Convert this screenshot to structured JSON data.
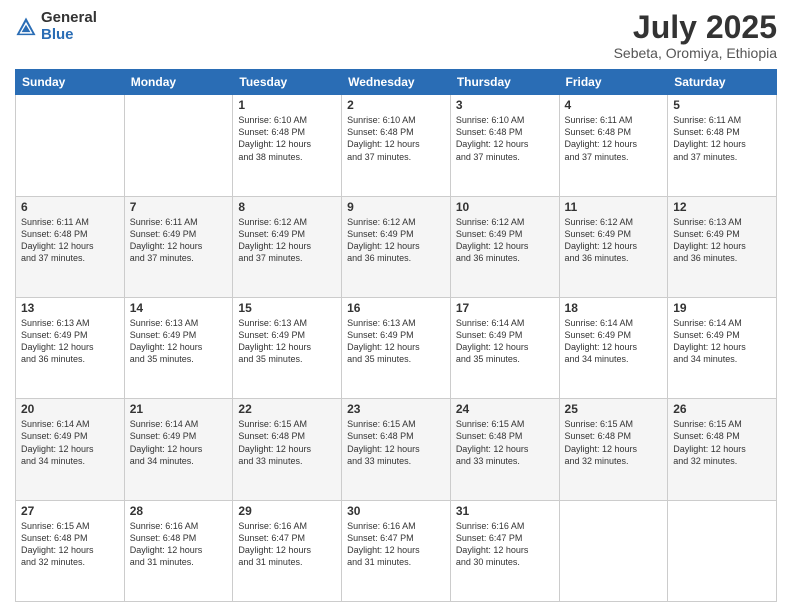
{
  "header": {
    "logo_general": "General",
    "logo_blue": "Blue",
    "month_year": "July 2025",
    "location": "Sebeta, Oromiya, Ethiopia"
  },
  "weekdays": [
    "Sunday",
    "Monday",
    "Tuesday",
    "Wednesday",
    "Thursday",
    "Friday",
    "Saturday"
  ],
  "weeks": [
    [
      {
        "day": "",
        "info": ""
      },
      {
        "day": "",
        "info": ""
      },
      {
        "day": "1",
        "info": "Sunrise: 6:10 AM\nSunset: 6:48 PM\nDaylight: 12 hours\nand 38 minutes."
      },
      {
        "day": "2",
        "info": "Sunrise: 6:10 AM\nSunset: 6:48 PM\nDaylight: 12 hours\nand 37 minutes."
      },
      {
        "day": "3",
        "info": "Sunrise: 6:10 AM\nSunset: 6:48 PM\nDaylight: 12 hours\nand 37 minutes."
      },
      {
        "day": "4",
        "info": "Sunrise: 6:11 AM\nSunset: 6:48 PM\nDaylight: 12 hours\nand 37 minutes."
      },
      {
        "day": "5",
        "info": "Sunrise: 6:11 AM\nSunset: 6:48 PM\nDaylight: 12 hours\nand 37 minutes."
      }
    ],
    [
      {
        "day": "6",
        "info": "Sunrise: 6:11 AM\nSunset: 6:48 PM\nDaylight: 12 hours\nand 37 minutes."
      },
      {
        "day": "7",
        "info": "Sunrise: 6:11 AM\nSunset: 6:49 PM\nDaylight: 12 hours\nand 37 minutes."
      },
      {
        "day": "8",
        "info": "Sunrise: 6:12 AM\nSunset: 6:49 PM\nDaylight: 12 hours\nand 37 minutes."
      },
      {
        "day": "9",
        "info": "Sunrise: 6:12 AM\nSunset: 6:49 PM\nDaylight: 12 hours\nand 36 minutes."
      },
      {
        "day": "10",
        "info": "Sunrise: 6:12 AM\nSunset: 6:49 PM\nDaylight: 12 hours\nand 36 minutes."
      },
      {
        "day": "11",
        "info": "Sunrise: 6:12 AM\nSunset: 6:49 PM\nDaylight: 12 hours\nand 36 minutes."
      },
      {
        "day": "12",
        "info": "Sunrise: 6:13 AM\nSunset: 6:49 PM\nDaylight: 12 hours\nand 36 minutes."
      }
    ],
    [
      {
        "day": "13",
        "info": "Sunrise: 6:13 AM\nSunset: 6:49 PM\nDaylight: 12 hours\nand 36 minutes."
      },
      {
        "day": "14",
        "info": "Sunrise: 6:13 AM\nSunset: 6:49 PM\nDaylight: 12 hours\nand 35 minutes."
      },
      {
        "day": "15",
        "info": "Sunrise: 6:13 AM\nSunset: 6:49 PM\nDaylight: 12 hours\nand 35 minutes."
      },
      {
        "day": "16",
        "info": "Sunrise: 6:13 AM\nSunset: 6:49 PM\nDaylight: 12 hours\nand 35 minutes."
      },
      {
        "day": "17",
        "info": "Sunrise: 6:14 AM\nSunset: 6:49 PM\nDaylight: 12 hours\nand 35 minutes."
      },
      {
        "day": "18",
        "info": "Sunrise: 6:14 AM\nSunset: 6:49 PM\nDaylight: 12 hours\nand 34 minutes."
      },
      {
        "day": "19",
        "info": "Sunrise: 6:14 AM\nSunset: 6:49 PM\nDaylight: 12 hours\nand 34 minutes."
      }
    ],
    [
      {
        "day": "20",
        "info": "Sunrise: 6:14 AM\nSunset: 6:49 PM\nDaylight: 12 hours\nand 34 minutes."
      },
      {
        "day": "21",
        "info": "Sunrise: 6:14 AM\nSunset: 6:49 PM\nDaylight: 12 hours\nand 34 minutes."
      },
      {
        "day": "22",
        "info": "Sunrise: 6:15 AM\nSunset: 6:48 PM\nDaylight: 12 hours\nand 33 minutes."
      },
      {
        "day": "23",
        "info": "Sunrise: 6:15 AM\nSunset: 6:48 PM\nDaylight: 12 hours\nand 33 minutes."
      },
      {
        "day": "24",
        "info": "Sunrise: 6:15 AM\nSunset: 6:48 PM\nDaylight: 12 hours\nand 33 minutes."
      },
      {
        "day": "25",
        "info": "Sunrise: 6:15 AM\nSunset: 6:48 PM\nDaylight: 12 hours\nand 32 minutes."
      },
      {
        "day": "26",
        "info": "Sunrise: 6:15 AM\nSunset: 6:48 PM\nDaylight: 12 hours\nand 32 minutes."
      }
    ],
    [
      {
        "day": "27",
        "info": "Sunrise: 6:15 AM\nSunset: 6:48 PM\nDaylight: 12 hours\nand 32 minutes."
      },
      {
        "day": "28",
        "info": "Sunrise: 6:16 AM\nSunset: 6:48 PM\nDaylight: 12 hours\nand 31 minutes."
      },
      {
        "day": "29",
        "info": "Sunrise: 6:16 AM\nSunset: 6:47 PM\nDaylight: 12 hours\nand 31 minutes."
      },
      {
        "day": "30",
        "info": "Sunrise: 6:16 AM\nSunset: 6:47 PM\nDaylight: 12 hours\nand 31 minutes."
      },
      {
        "day": "31",
        "info": "Sunrise: 6:16 AM\nSunset: 6:47 PM\nDaylight: 12 hours\nand 30 minutes."
      },
      {
        "day": "",
        "info": ""
      },
      {
        "day": "",
        "info": ""
      }
    ]
  ]
}
